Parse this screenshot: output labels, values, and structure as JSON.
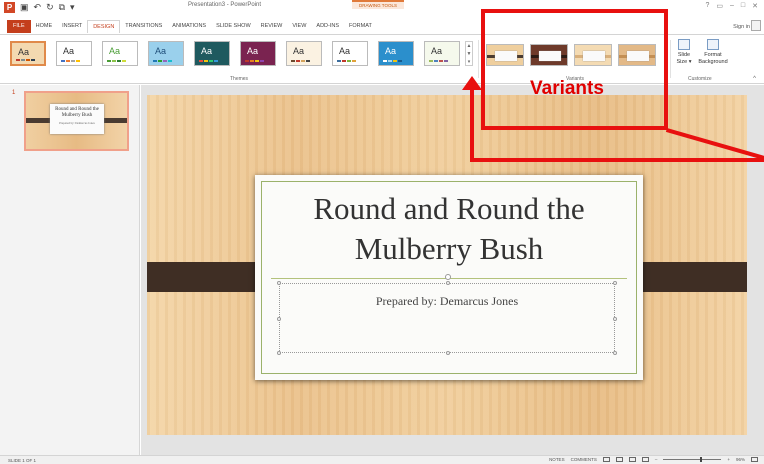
{
  "app": {
    "title": "Presentation3 - PowerPoint",
    "contextual_tab": "DRAWING TOOLS"
  },
  "tabs": [
    "FILE",
    "HOME",
    "INSERT",
    "DESIGN",
    "TRANSITIONS",
    "ANIMATIONS",
    "SLIDE SHOW",
    "REVIEW",
    "VIEW",
    "ADD-INS",
    "FORMAT"
  ],
  "active_tab": "DESIGN",
  "account": {
    "signin": "Sign in"
  },
  "window_controls": [
    "?",
    "▭",
    "–",
    "□",
    "✕"
  ],
  "ribbon": {
    "themes_label": "Themes",
    "variants_label": "Variants",
    "customize_label": "Customize",
    "theme_sample_text": "Aa",
    "slide_size": "Slide Size ▾",
    "format_background": "Format Background",
    "themes": [
      {
        "bg": "#f3d9b0",
        "fg": "#333",
        "bars": [
          "#c0392b",
          "#7f8c8d",
          "#d35400",
          "#2c3e50"
        ]
      },
      {
        "bg": "#ffffff",
        "fg": "#333",
        "bars": [
          "#4472c4",
          "#ed7d31",
          "#a5a5a5",
          "#ffc000"
        ]
      },
      {
        "bg": "#ffffff",
        "fg": "#4a9d36",
        "bars": [
          "#4a9d36",
          "#8bc34a",
          "#2e7d32",
          "#cddc39"
        ]
      },
      {
        "bg": "#9ad0ec",
        "fg": "#1f4e79",
        "bars": [
          "#1f77b4",
          "#2ca02c",
          "#9467bd",
          "#17becf"
        ]
      },
      {
        "bg": "#1f5a5f",
        "fg": "#ffffff",
        "bars": [
          "#e74c3c",
          "#f1c40f",
          "#2ecc71",
          "#3498db"
        ]
      },
      {
        "bg": "#7a2350",
        "fg": "#ffffff",
        "bars": [
          "#c0392b",
          "#e67e22",
          "#f1c40f",
          "#8e44ad"
        ]
      },
      {
        "bg": "#fbf2e2",
        "fg": "#333",
        "bars": [
          "#6b4a2f",
          "#c0392b",
          "#d4a35c",
          "#444"
        ]
      },
      {
        "bg": "#ffffff",
        "fg": "#333",
        "bars": [
          "#3c6e9e",
          "#c0392b",
          "#7fb53c",
          "#e0a23a"
        ]
      },
      {
        "bg": "#2b8fcc",
        "fg": "#ffffff",
        "bars": [
          "#ffffff",
          "#a7d7f0",
          "#f1c40f",
          "#1a5a8a"
        ]
      },
      {
        "bg": "#f5f9ec",
        "fg": "#333",
        "bars": [
          "#9bbb59",
          "#4f81bd",
          "#c0504d",
          "#8064a2"
        ]
      }
    ],
    "variants": [
      {
        "bg": "#efcf9e",
        "stripe": "#4a3b31"
      },
      {
        "bg": "#6e3a2a",
        "stripe": "#2b1a13"
      },
      {
        "bg": "#f4dbb3",
        "stripe": "#d9b07c"
      },
      {
        "bg": "#e3b987",
        "stripe": "#c48f54"
      }
    ]
  },
  "thumbnail": {
    "number": "1",
    "title": "Round and Round the Mulberry Bush",
    "subtitle": "Prepared by: Demarcus Jones"
  },
  "slide": {
    "title": "Round and Round the Mulberry Bush",
    "subtitle": "Prepared by: Demarcus Jones"
  },
  "status": {
    "slide_counter": "SLIDE 1 OF 1",
    "notes": "NOTES",
    "comments": "COMMENTS",
    "zoom": "96%"
  },
  "annotation": {
    "label": "Variants",
    "color": "#e8100f"
  }
}
